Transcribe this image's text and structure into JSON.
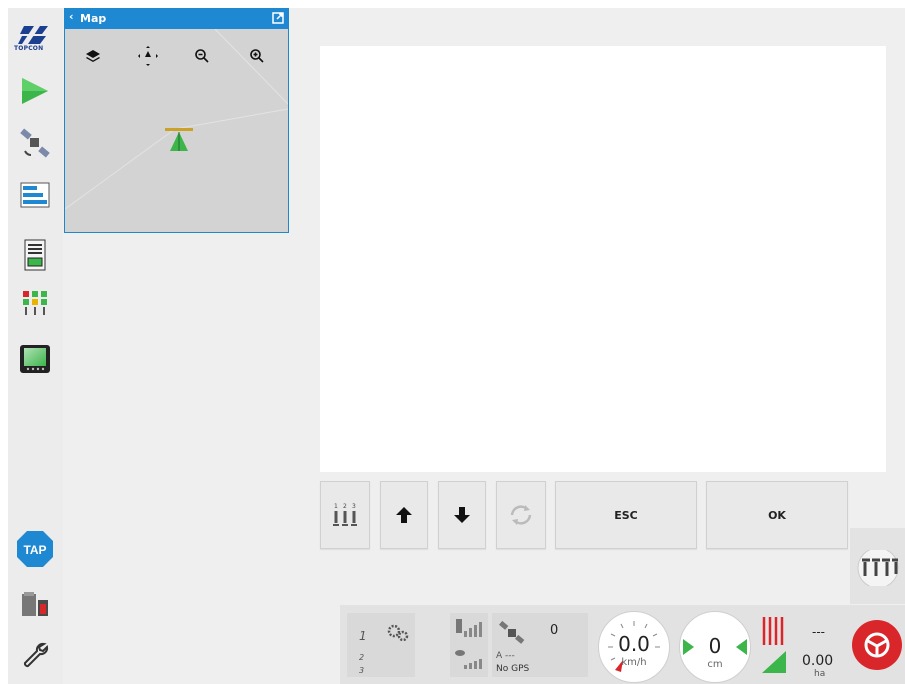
{
  "sidebar": {
    "logo_text": "TOPCON",
    "items": [
      {
        "name": "run-screen-icon"
      },
      {
        "name": "gps-satellite-icon"
      },
      {
        "name": "layout-bars-icon"
      },
      {
        "name": "job-document-icon"
      },
      {
        "name": "section-control-icon"
      },
      {
        "name": "display-screen-icon"
      }
    ],
    "tap_label": "TAP"
  },
  "map_panel": {
    "back_label": "‹",
    "title": "Map",
    "tools": [
      "layers-icon",
      "pan-icon",
      "zoom-out-icon",
      "zoom-in-icon"
    ]
  },
  "buttons": {
    "esc_label": "ESC",
    "ok_label": "OK"
  },
  "status": {
    "satellite_count": "0",
    "gps_dash": "A ---",
    "gps_status": "No GPS",
    "speed_value": "0.0",
    "speed_unit": "km/h",
    "offset_value": "0",
    "offset_unit": "cm",
    "area_dash": "---",
    "area_value": "0.00",
    "area_unit": "ha",
    "row1_num": "1",
    "row2_num": "2",
    "row3_num": "3"
  },
  "colors": {
    "accent_blue": "#1e88d2",
    "green": "#3cb54a",
    "red": "#d9262b"
  }
}
